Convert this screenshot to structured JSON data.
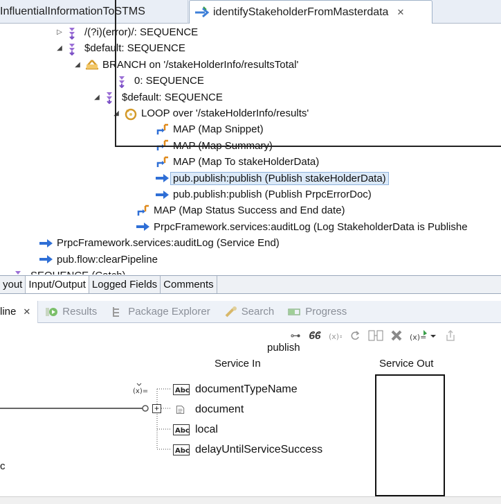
{
  "editor_tabs": [
    {
      "label": "InfluentialInformationToSTMS"
    },
    {
      "label": "identifyStakeholderFromMasterdata",
      "close": "✕"
    }
  ],
  "flow_tree": [
    {
      "indent": 78,
      "twisty": "▷",
      "icon": "sequence-icon",
      "label": "/(?i)(error)/: SEQUENCE"
    },
    {
      "indent": 78,
      "twisty": "◢",
      "icon": "sequence-icon",
      "label": "$default: SEQUENCE"
    },
    {
      "indent": 104,
      "twisty": "◢",
      "icon": "branch-icon",
      "label": "BRANCH on '/stakeHolderInfo/resultsTotal'"
    },
    {
      "indent": 150,
      "twisty": "",
      "icon": "sequence-icon",
      "label": "0: SEQUENCE"
    },
    {
      "indent": 132,
      "twisty": "◢",
      "icon": "sequence-icon",
      "label": "$default: SEQUENCE"
    },
    {
      "indent": 160,
      "twisty": "◢",
      "icon": "loop-icon",
      "label": "LOOP over '/stakeHolderInfo/results'"
    },
    {
      "indent": 206,
      "twisty": "",
      "icon": "map-icon",
      "label": "MAP (Map Snippet)"
    },
    {
      "indent": 206,
      "twisty": "",
      "icon": "map-icon",
      "label": "MAP (Map Summary)"
    },
    {
      "indent": 206,
      "twisty": "",
      "icon": "map-icon",
      "label": "MAP (Map To stakeHolderData)"
    },
    {
      "indent": 206,
      "twisty": "",
      "icon": "invoke-icon",
      "label": "pub.publish:publish (Publish stakeHolderData)",
      "selected": true
    },
    {
      "indent": 206,
      "twisty": "",
      "icon": "invoke-icon",
      "label": "pub.publish:publish (Publish PrpcErrorDoc)"
    },
    {
      "indent": 178,
      "twisty": "",
      "icon": "map-icon",
      "label": "MAP (Map Status Success and End date)"
    },
    {
      "indent": 178,
      "twisty": "",
      "icon": "invoke-icon",
      "label": "PrpcFramework.services:auditLog (Log StakeholderData is Publishe"
    },
    {
      "indent": 38,
      "twisty": "",
      "icon": "invoke-icon",
      "label": "PrpcFramework.services:auditLog (Service End)"
    },
    {
      "indent": 38,
      "twisty": "",
      "icon": "invoke-icon",
      "label": "pub.flow:clearPipeline"
    },
    {
      "indent": 0,
      "twisty": "",
      "icon": "sequence-icon",
      "label": "SEQUENCE (Catch)"
    }
  ],
  "property_tabs": [
    "yout",
    "Input/Output",
    "Logged Fields",
    "Comments"
  ],
  "view_tabs": [
    {
      "label": "line",
      "close": "✕",
      "active": true
    },
    {
      "label": "Results",
      "icon": "results-icon"
    },
    {
      "label": "Package Explorer",
      "icon": "package-explorer-icon"
    },
    {
      "label": "Search",
      "icon": "search-icon"
    },
    {
      "label": "Progress",
      "icon": "progress-icon"
    }
  ],
  "toolbar": {
    "link_label": "⊶",
    "chain_label": "ϐϐ"
  },
  "pipeline": {
    "service_name": "publish",
    "service_in_label": "Service In",
    "service_out_label": "Service Out",
    "fields": [
      {
        "name": "documentTypeName",
        "type": "string"
      },
      {
        "name": "document",
        "type": "document"
      },
      {
        "name": "local",
        "type": "string"
      },
      {
        "name": "delayUntilServiceSuccess",
        "type": "string"
      }
    ],
    "left_fragment": "c",
    "string_type_label": "Abc"
  },
  "colors": {
    "sequence": "#9b6fd6",
    "invoke": "#2f6fd6",
    "map_orange": "#e08a1c",
    "selection": "#dbe9f8"
  }
}
